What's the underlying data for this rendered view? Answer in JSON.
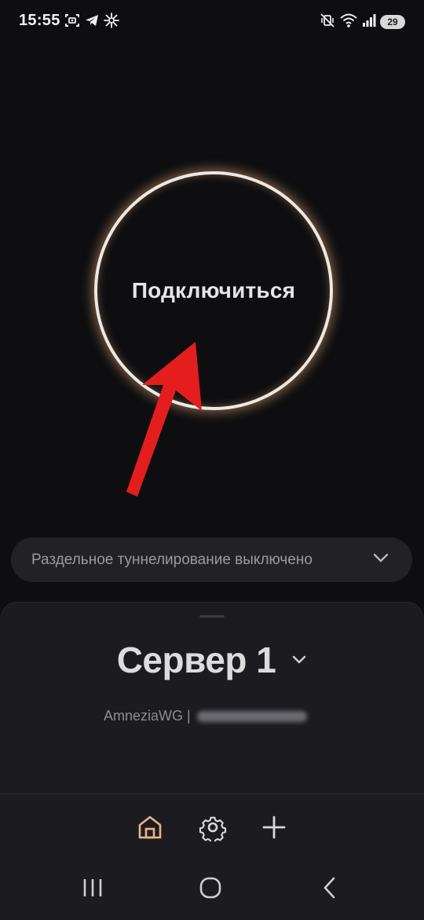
{
  "status_bar": {
    "time": "15:55",
    "battery": "29",
    "left_icons": [
      "screenshot-icon",
      "telegram-icon",
      "sparkle-icon"
    ],
    "right_icons": [
      "mute-vibrate-icon",
      "wifi-icon",
      "signal-icon",
      "battery-icon"
    ]
  },
  "main": {
    "connect_label": "Подключиться",
    "split_tunneling_label": "Раздельное туннелирование выключено"
  },
  "sheet": {
    "server_name": "Сервер 1",
    "protocol": "AmneziaWG |"
  },
  "nav": {
    "items": [
      "home-icon",
      "settings-icon",
      "add-icon"
    ],
    "active": "home-icon"
  },
  "system_nav": [
    "recent-apps-icon",
    "home-button-icon",
    "back-icon"
  ],
  "colors": {
    "background": "#0e0e10",
    "sheet": "#1c1c20",
    "ring": "#efe8e2",
    "ring_glow": "#e1a578",
    "accent": "#e7b48a",
    "annotation_arrow": "#e41e1e"
  }
}
